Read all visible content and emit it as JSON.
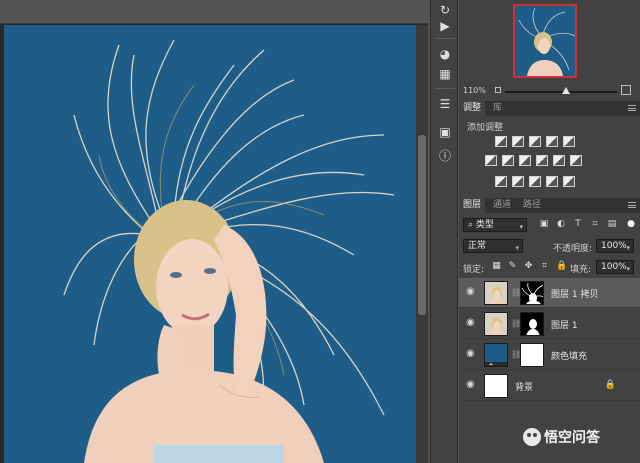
{
  "navigator": {
    "zoom": "110%"
  },
  "adjustments": {
    "tabs": [
      "调整",
      "库"
    ],
    "title": "添加调整",
    "row1_icons": [
      "brightness-icon",
      "levels-icon",
      "curves-icon",
      "exposure-icon",
      "vibrance-icon"
    ],
    "row2_icons": [
      "hue-saturation-icon",
      "color-balance-icon",
      "black-white-icon",
      "photo-filter-icon",
      "channel-mixer-icon",
      "color-lookup-icon"
    ],
    "row3_icons": [
      "invert-icon",
      "posterize-icon",
      "threshold-icon",
      "selective-color-icon",
      "gradient-map-icon"
    ]
  },
  "layers": {
    "tabs": [
      "图层",
      "通道",
      "路径"
    ],
    "filter_kind": "类型",
    "blend_mode": "正常",
    "opacity_label": "不透明度:",
    "opacity_value": "100%",
    "lock_label": "锁定:",
    "fill_label": "填充:",
    "fill_value": "100%",
    "items": [
      {
        "name": "图层 1 拷贝",
        "selected": true
      },
      {
        "name": "图层 1",
        "selected": false
      },
      {
        "name": "颜色填充",
        "selected": false
      },
      {
        "name": "背景",
        "selected": false
      }
    ]
  },
  "watermark": {
    "text": "悟空问答"
  },
  "colors": {
    "canvas_bg": "#1e5d88",
    "panel_bg": "#424242",
    "selected_layer": "#5b5b5b"
  }
}
